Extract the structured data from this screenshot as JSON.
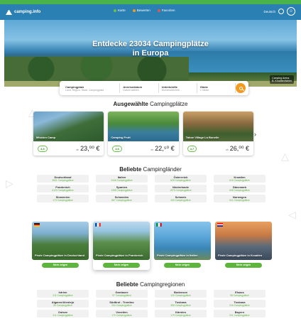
{
  "header": {
    "logo_text": "camping.info",
    "nav": [
      {
        "label": "Karte",
        "color": "#6cc04a"
      },
      {
        "label": "Bewerten",
        "color": "#f39a1e"
      },
      {
        "label": "Favoriten",
        "color": "#e4574f"
      }
    ],
    "language": "Deutsch"
  },
  "hero": {
    "title_line1": "Entdecke 23034 Campingplätze",
    "title_line2": "in Europa",
    "badge_line1": "Camping Arena",
    "badge_line2": "B. Kroatien/Istrien"
  },
  "search": {
    "fields": [
      {
        "label": "Campingplatz",
        "value": "Land, Region, Stadt, Campingplatz"
      },
      {
        "label": "Anreisedatum",
        "value": "Datum wählen"
      },
      {
        "label": "Unterkünfte",
        "value": "Wohnmobil/Zelt/..."
      },
      {
        "label": "Gäste",
        "value": "2 Gäste"
      }
    ]
  },
  "featured": {
    "title_bold": "Ausgewählte",
    "title_rest": " Campingplätze",
    "cards": [
      {
        "name": "Mission Camp",
        "rating": "4,5",
        "price_prefix": "ab",
        "price": "23,⁰⁰ €"
      },
      {
        "name": "Camping Frutt",
        "rating": "4,6",
        "price_prefix": "ab",
        "price": "22,⁵⁰ €"
      },
      {
        "name": "Tahoe Village La Bonelle",
        "rating": "4,7",
        "price_prefix": "ab",
        "price": "26,⁰⁰ €"
      }
    ]
  },
  "countries": {
    "title_bold": "Beliebte",
    "title_rest": " Campingländer",
    "items": [
      {
        "name": "Deutschland",
        "count": "3541 Campingplätze"
      },
      {
        "name": "Italien",
        "count": "2446 Campingplätze"
      },
      {
        "name": "Österreich",
        "count": "625 Campingplätze"
      },
      {
        "name": "Kroatien",
        "count": "615 Campingplätze"
      },
      {
        "name": "Frankreich",
        "count": "6123 Campingplätze"
      },
      {
        "name": "Spanien",
        "count": "1185 Campingplätze"
      },
      {
        "name": "Niederlande",
        "count": "1575 Campingplätze"
      },
      {
        "name": "Dänemark",
        "count": "608 Campingplätze"
      },
      {
        "name": "Slowenien",
        "count": "173 Campingplätze"
      },
      {
        "name": "Schweden",
        "count": "867 Campingplätze"
      },
      {
        "name": "Schweiz",
        "count": "430 Campingplätze"
      },
      {
        "name": "Norwegen",
        "count": "541 Campingplätze"
      }
    ]
  },
  "regions_cards": [
    {
      "name": "Finde Campingplätze in Deutschland",
      "button": "Mehr zeigen",
      "flag": "de"
    },
    {
      "name": "Finde Campingplätze in Frankreich",
      "button": "Mehr zeigen",
      "flag": "fr"
    },
    {
      "name": "Finde Campingplätze in Italien",
      "button": "Mehr zeigen",
      "flag": "it"
    },
    {
      "name": "Finde Campingplätze in Kroatien",
      "button": "Mehr zeigen",
      "flag": "hr"
    }
  ],
  "regions": {
    "title_bold": "Beliebte",
    "title_rest": " Campingregionen",
    "items": [
      {
        "name": "Istrien",
        "count": "211 Campingplätze"
      },
      {
        "name": "Gardasee",
        "count": "97 Campingplätze"
      },
      {
        "name": "Bodensee",
        "count": "120 Campingplätze"
      },
      {
        "name": "Elsass",
        "count": "98 Campingplätze"
      },
      {
        "name": "Algarve/Alentejo",
        "count": "85 Campingplätze"
      },
      {
        "name": "Südtirol - Trentino",
        "count": "254 Campingplätze"
      },
      {
        "name": "Toskana",
        "count": "358 Campingplätze"
      },
      {
        "name": "Toskana",
        "count": "316 Campingplätze"
      },
      {
        "name": "Ostsee",
        "count": "311 Campingplätze"
      },
      {
        "name": "Venetien",
        "count": "170 Campingplätze"
      },
      {
        "name": "Kärnten",
        "count": "179 Campingplätze"
      },
      {
        "name": "Bayern",
        "count": "511 Campingplätze"
      }
    ]
  }
}
